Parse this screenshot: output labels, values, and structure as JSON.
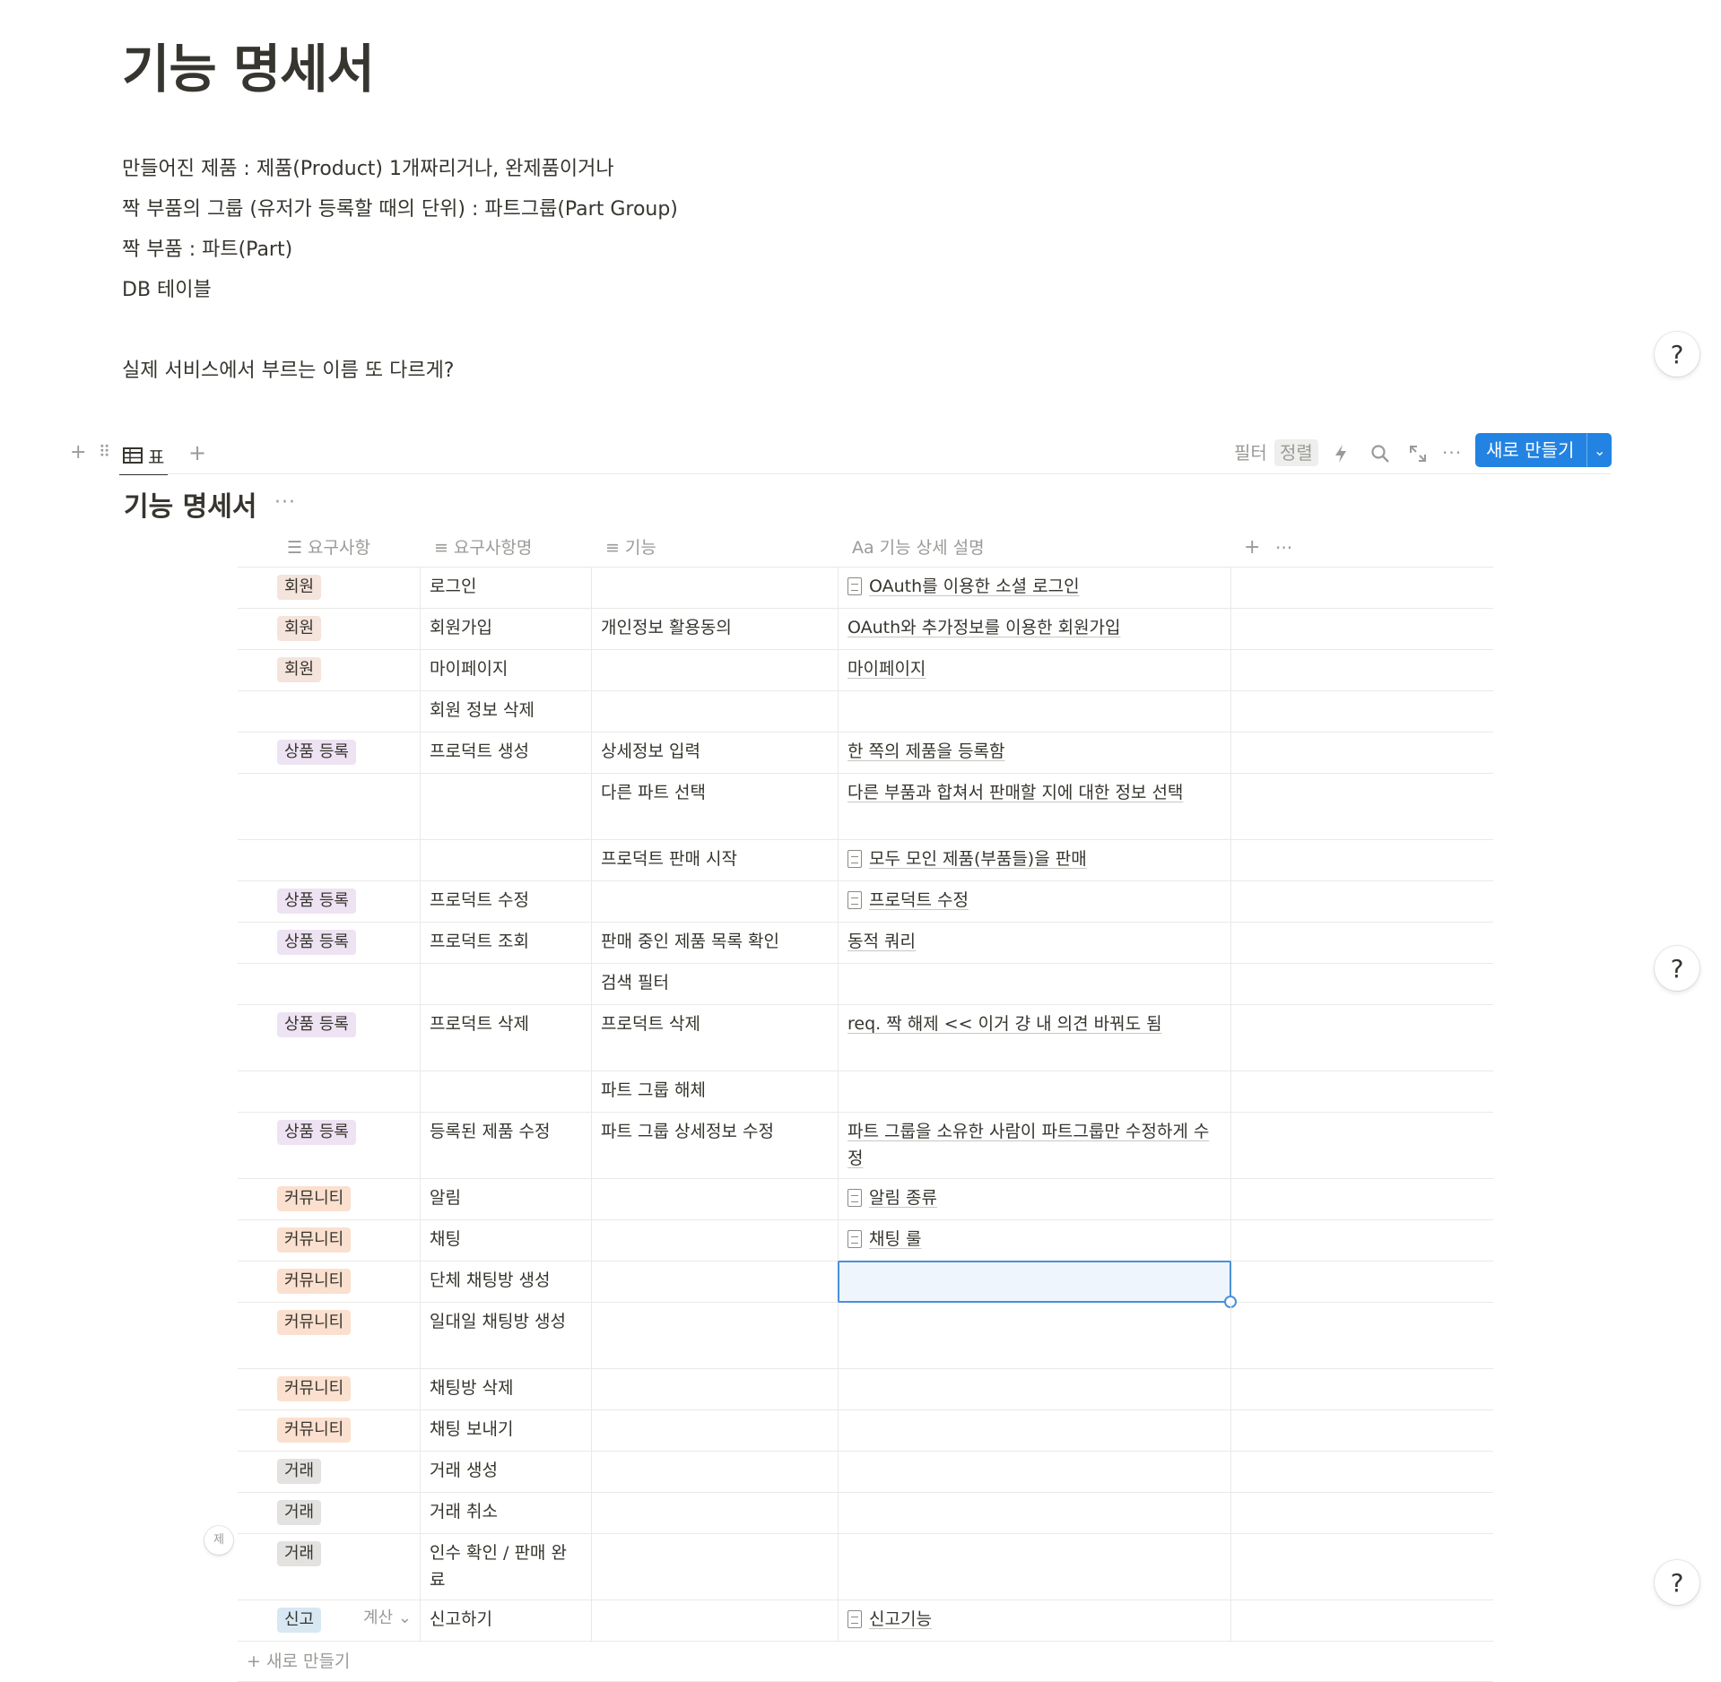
{
  "page": {
    "title": "기능 명세서",
    "description_lines": [
      "만들어진 제품 : 제품(Product) 1개짜리거나, 완제품이거나",
      "짝 부품의 그룹 (유저가 등록할 때의 단위) : 파트그룹(Part Group)",
      "짝 부품 : 파트(Part)",
      "DB 테이블",
      "실제 서비스에서 부르는 이름 또 다르게?"
    ],
    "help_label": "?"
  },
  "view_bar": {
    "add_icon": "plus-icon",
    "drag_icon": "drag-handle-icon",
    "tab_icon": "table-icon",
    "tab_label": "표",
    "add_view_icon": "plus-icon",
    "filter_label": "필터",
    "sort_label": "정렬",
    "automation_icon": "lightning-icon",
    "search_icon": "search-icon",
    "expand_icon": "expand-icon",
    "more_icon": "more-icon",
    "new_button_label": "새로 만들기",
    "new_button_caret": "chevron-down-icon"
  },
  "database": {
    "title": "기능 명세서",
    "more_label": "···",
    "columns": [
      {
        "icon": "☰",
        "label": "요구사항"
      },
      {
        "icon": "≡",
        "label": "요구사항명"
      },
      {
        "icon": "≡",
        "label": "기능"
      },
      {
        "icon": "Aa",
        "label": "기능 상세 설명"
      }
    ],
    "add_column_label": "+",
    "column_more_label": "···",
    "tag_colors": {
      "회원": "#f4e4dc",
      "상품 등록": "#ede3f3",
      "커뮤니티": "#fbe0cf",
      "거래": "#e3e2e0",
      "신고": "#d8e8f3"
    },
    "rows": [
      {
        "tag": "회원",
        "name": "로그인",
        "feature": "",
        "detail": "OAuth를 이용한 소셜 로그인",
        "detail_page": true
      },
      {
        "tag": "회원",
        "name": "회원가입",
        "feature": "개인정보 활용동의",
        "detail": "OAuth와 추가정보를 이용한 회원가입",
        "detail_page": false
      },
      {
        "tag": "회원",
        "name": "마이페이지",
        "feature": "",
        "detail": "마이페이지",
        "detail_page": false
      },
      {
        "tag": "",
        "name": "회원 정보 삭제",
        "feature": "",
        "detail": "",
        "detail_page": false
      },
      {
        "tag": "상품 등록",
        "name": "프로덕트 생성",
        "feature": "상세정보 입력",
        "detail": "한 쪽의 제품을 등록함",
        "detail_page": false
      },
      {
        "tag": "",
        "name": "",
        "feature": "다른 파트 선택",
        "detail": "다른 부품과 합쳐서 판매할 지에 대한 정보 선택",
        "detail_page": false
      },
      {
        "tag": "",
        "name": "",
        "feature": "프로덕트 판매 시작",
        "detail": "모두 모인 제품(부품들)을 판매",
        "detail_page": true
      },
      {
        "tag": "상품 등록",
        "name": "프로덕트 수정",
        "feature": "",
        "detail": "프로덕트 수정",
        "detail_page": true
      },
      {
        "tag": "상품 등록",
        "name": "프로덕트 조회",
        "feature": "판매 중인 제품 목록 확인",
        "detail": "동적 쿼리",
        "detail_page": false
      },
      {
        "tag": "",
        "name": "",
        "feature": "검색 필터",
        "detail": "",
        "detail_page": false
      },
      {
        "tag": "상품 등록",
        "name": "프로덕트 삭제",
        "feature": "프로덕트 삭제",
        "detail": "req. 짝 해제 << 이거 걍 내 의견 바꿔도 됨",
        "detail_page": false
      },
      {
        "tag": "",
        "name": "",
        "feature": "파트 그룹 해체",
        "detail": "",
        "detail_page": false
      },
      {
        "tag": "상품 등록",
        "name": "등록된 제품 수정",
        "feature": "파트 그룹 상세정보 수정",
        "detail": "파트 그룹을 소유한 사람이 파트그룹만 수정하게 수정",
        "detail_page": false
      },
      {
        "tag": "커뮤니티",
        "name": "알림",
        "feature": "",
        "detail": "알림 종류",
        "detail_page": true
      },
      {
        "tag": "커뮤니티",
        "name": "채팅",
        "feature": "",
        "detail": "채팅 룰",
        "detail_page": true
      },
      {
        "tag": "커뮤니티",
        "name": "단체 채팅방 생성",
        "feature": "",
        "detail": "",
        "detail_page": false,
        "selected": true
      },
      {
        "tag": "커뮤니티",
        "name": "일대일 채팅방 생성",
        "feature": "",
        "detail": "",
        "detail_page": false
      },
      {
        "tag": "커뮤니티",
        "name": "채팅방 삭제",
        "feature": "",
        "detail": "",
        "detail_page": false
      },
      {
        "tag": "커뮤니티",
        "name": "채팅 보내기",
        "feature": "",
        "detail": "",
        "detail_page": false
      },
      {
        "tag": "거래",
        "name": "거래 생성",
        "feature": "",
        "detail": "",
        "detail_page": false
      },
      {
        "tag": "거래",
        "name": "거래 취소",
        "feature": "",
        "detail": "",
        "detail_page": false
      },
      {
        "tag": "거래",
        "name": "인수 확인 / 판매 완료",
        "feature": "",
        "detail": "",
        "detail_page": false
      },
      {
        "tag": "신고",
        "name": "신고하기",
        "feature": "",
        "detail": "신고기능",
        "detail_page": true
      }
    ],
    "row_handle_label": "제",
    "add_row_label": "+ 새로 만들기",
    "calc_label": "계산 ⌄"
  }
}
